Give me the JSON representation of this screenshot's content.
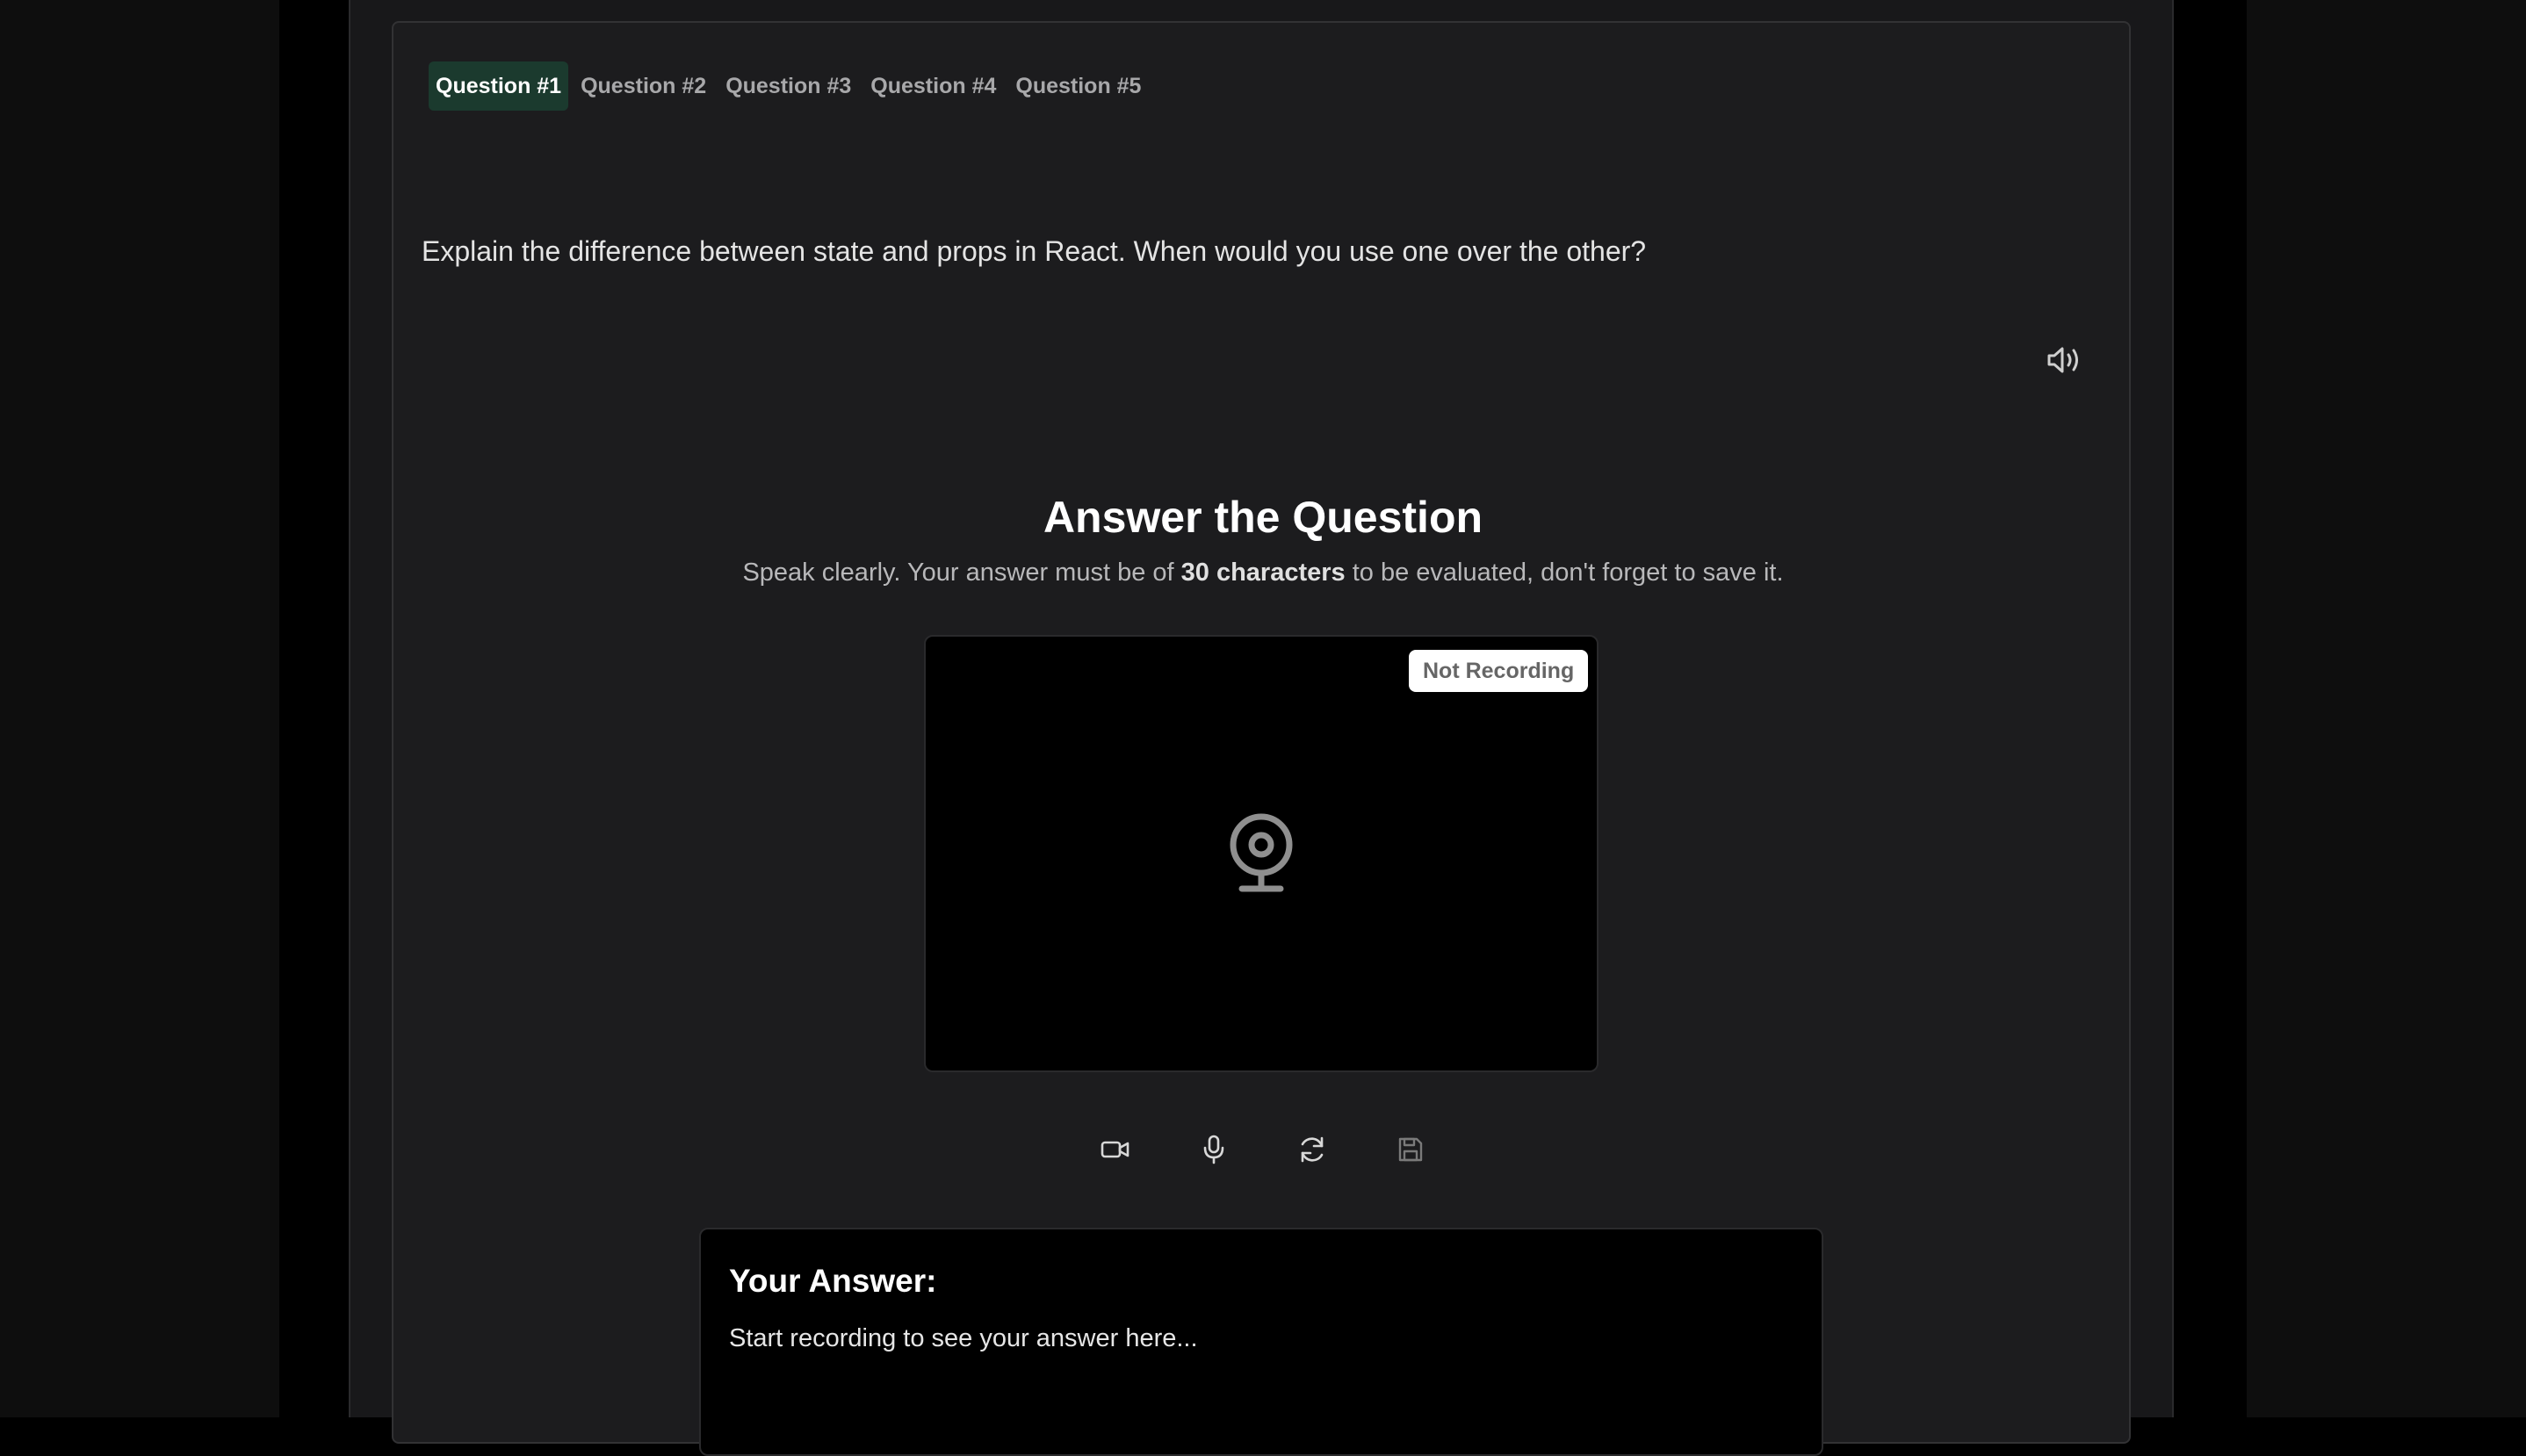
{
  "tabs": [
    {
      "label": "Question #1",
      "active": true
    },
    {
      "label": "Question #2",
      "active": false
    },
    {
      "label": "Question #3",
      "active": false
    },
    {
      "label": "Question #4",
      "active": false
    },
    {
      "label": "Question #5",
      "active": false
    }
  ],
  "question": {
    "text": "Explain the difference between state and props in React. When would you use one over the other?",
    "speaker_icon": "speaker-icon"
  },
  "answer_section": {
    "title": "Answer the Question",
    "hint_before": "Speak clearly. Your answer must be of ",
    "hint_emphasis": "30 characters",
    "hint_after": " to be evaluated, don't forget to save it."
  },
  "video": {
    "status_badge": "Not Recording",
    "placeholder_icon": "webcam-icon"
  },
  "controls": [
    {
      "name": "video-camera-button",
      "icon": "video-camera-icon"
    },
    {
      "name": "microphone-button",
      "icon": "microphone-icon"
    },
    {
      "name": "refresh-button",
      "icon": "refresh-icon"
    },
    {
      "name": "save-button",
      "icon": "save-icon"
    }
  ],
  "your_answer": {
    "label": "Your Answer:",
    "placeholder": "Start recording to see your answer here..."
  },
  "colors": {
    "active_tab_bg": "#1b3a2e",
    "card_bg": "#1c1c1e",
    "page_bg": "#000000"
  }
}
